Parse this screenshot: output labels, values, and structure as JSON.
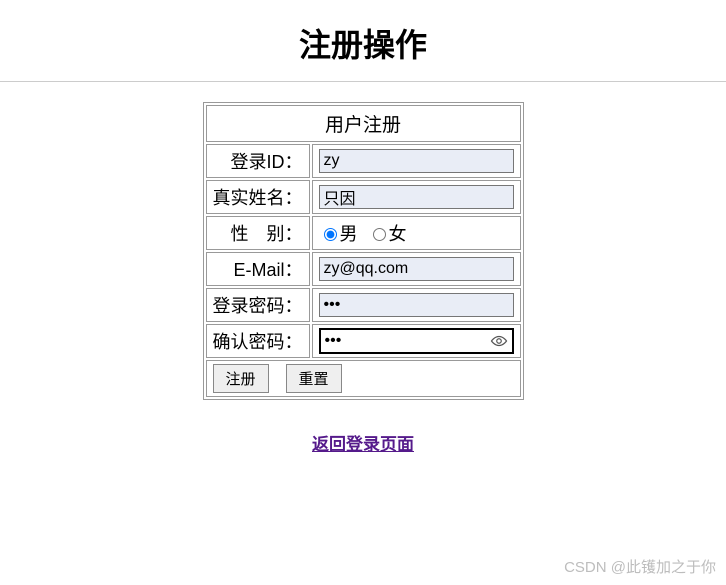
{
  "page": {
    "heading": "注册操作"
  },
  "form": {
    "title": "用户注册",
    "login_id": {
      "label": "登录ID：",
      "value": "zy"
    },
    "real_name": {
      "label": "真实姓名：",
      "value": "只因"
    },
    "gender": {
      "label": "性　别：",
      "options": {
        "male": "男",
        "female": "女"
      },
      "selected": "male"
    },
    "email": {
      "label": "E-Mail：",
      "value": "zy@qq.com"
    },
    "password": {
      "label": "登录密码：",
      "value": "•••"
    },
    "confirm_password": {
      "label": "确认密码：",
      "value": "•••"
    },
    "buttons": {
      "submit": "注册",
      "reset": "重置"
    }
  },
  "link": {
    "back": "返回登录页面"
  },
  "watermark": "CSDN @此镬加之于你"
}
